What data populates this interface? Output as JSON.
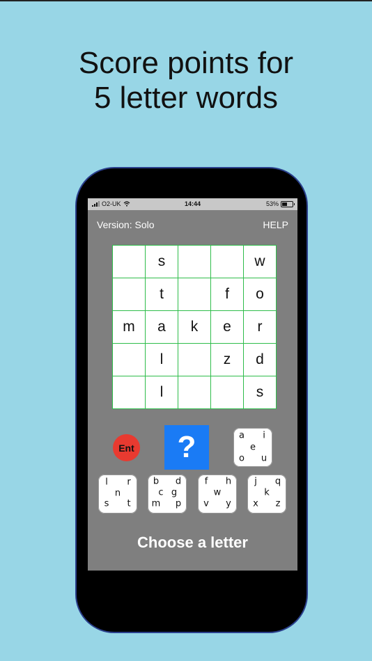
{
  "headline": {
    "line1": "Score points for",
    "line2": "5 letter words"
  },
  "statusbar": {
    "carrier": "O2-UK",
    "time": "14:44",
    "battery": "53%",
    "battery_level": 0.53
  },
  "header": {
    "version": "Version: Solo",
    "help": "HELP"
  },
  "grid": [
    [
      "",
      "s",
      "",
      "",
      "w"
    ],
    [
      "",
      "t",
      "",
      "f",
      "o"
    ],
    [
      "m",
      "a",
      "k",
      "e",
      "r"
    ],
    [
      "",
      "l",
      "",
      "z",
      "d"
    ],
    [
      "",
      "l",
      "",
      "",
      "s"
    ]
  ],
  "buttons": {
    "enter": "Ent",
    "hint": "?"
  },
  "tiles": [
    {
      "name": "vowels",
      "letters": [
        "a",
        "i",
        "e",
        "o",
        "u"
      ]
    },
    {
      "name": "lnrst",
      "letters": [
        "l",
        "r",
        "n",
        "s",
        "t"
      ]
    },
    {
      "name": "bcdmp",
      "letters": [
        "b",
        "d",
        "c",
        "g",
        "m",
        "p"
      ]
    },
    {
      "name": "fhwvy",
      "letters": [
        "f",
        "h",
        "w",
        "v",
        "y"
      ]
    },
    {
      "name": "jkqxz",
      "letters": [
        "j",
        "q",
        "k",
        "x",
        "z"
      ]
    }
  ],
  "prompt": "Choose a letter",
  "colors": {
    "background": "#98d6e6",
    "screen": "#7f7f7f",
    "grid_line": "#2ebd4a",
    "enter_button": "#e83a30",
    "hint_button": "#1a7bf5"
  }
}
